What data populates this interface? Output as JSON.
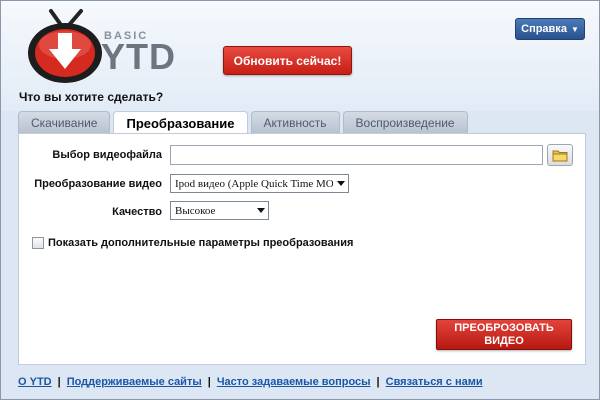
{
  "header": {
    "brand_small": "BASIC",
    "brand_large": "YTD",
    "update_label": "Обновить сейчас!",
    "help_label": "Справка"
  },
  "question": "Что вы хотите сделать?",
  "tabs": [
    {
      "label": "Скачивание",
      "active": false
    },
    {
      "label": "Преобразование",
      "active": true
    },
    {
      "label": "Активность",
      "active": false
    },
    {
      "label": "Воспроизведение",
      "active": false
    }
  ],
  "form": {
    "file_label": "Выбор видеофайла",
    "file_value": "",
    "convert_label": "Преобразование видео",
    "convert_value": "Ipod видео (Apple Quick Time MOV)",
    "quality_label": "Качество",
    "quality_value": "Высокое",
    "advanced_label": "Показать дополнительные параметры преобразования",
    "advanced_checked": false,
    "convert_button": "ПРЕОБРОЗОВАТЬ ВИДЕО"
  },
  "footer": {
    "links": [
      "О YTD",
      "Поддерживаемые сайты",
      "Часто задаваемые вопросы",
      "Связаться с нами"
    ],
    "separator": "|"
  },
  "colors": {
    "accent_red": "#c81e16",
    "help_blue": "#27528d",
    "link_blue": "#1a56a8",
    "window_bg": "#dde7f3"
  },
  "icons": {
    "logo": "tv-download-logo-icon",
    "folder": "folder-icon",
    "dropdown": "chevron-down-icon"
  }
}
